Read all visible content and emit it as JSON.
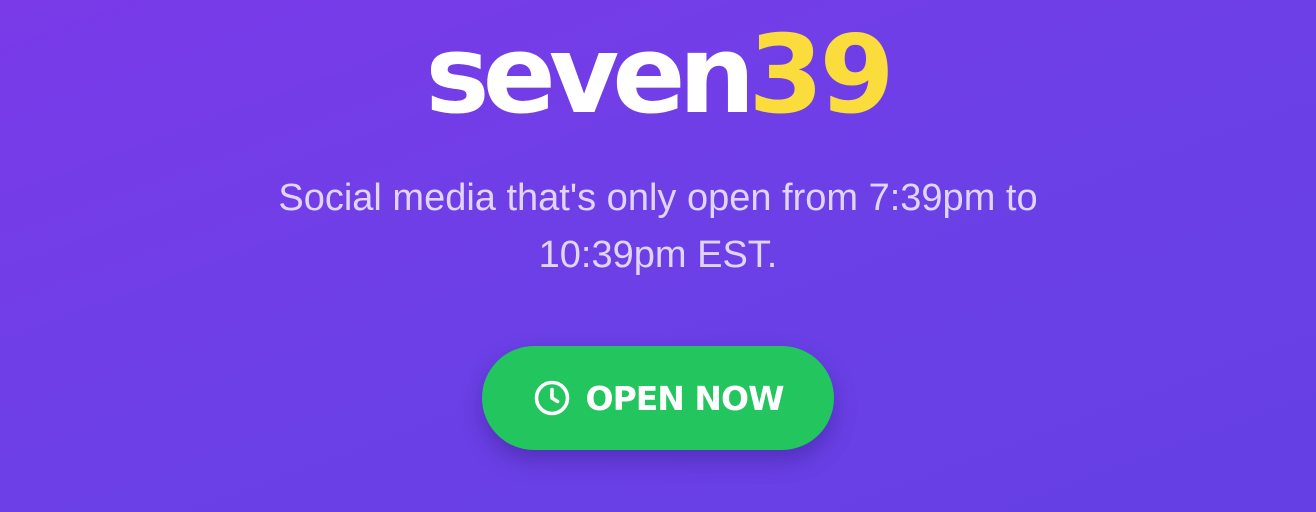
{
  "logo": {
    "word": "seven",
    "number": "39"
  },
  "tagline": "Social media that's only open from 7:39pm to 10:39pm EST.",
  "cta": {
    "label": "OPEN NOW",
    "icon": "clock-icon"
  },
  "colors": {
    "background": "#7a3ae8",
    "logo_word": "#ffffff",
    "logo_accent": "#fbdc3d",
    "tagline": "#e1d5fb",
    "button": "#22c55e",
    "button_text": "#ffffff"
  }
}
